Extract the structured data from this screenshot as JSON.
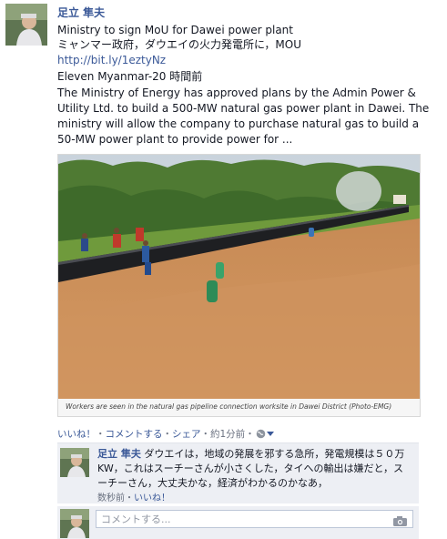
{
  "post": {
    "author": "足立 隼夫",
    "title_en": "Ministry to sign MoU for Dawei power plant",
    "title_jp": "ミャンマー政府，ダウエイの火力発電所に，MOU",
    "link": "http://bit.ly/1eztyNz",
    "source_time": "Eleven Myanmar-20 時間前",
    "body": "The Ministry of Energy has approved plans by the Admin Power & Utility Ltd. to build a 500-MW natural gas power plant in Dawei. The ministry will allow the company to purchase natural gas to build a 50-MW power plant to provide power for ...",
    "photo_caption": "Workers are seen in the natural gas pipeline connection worksite in Dawei District (Photo-EMG)"
  },
  "actions": {
    "like": "いいね！",
    "sep1": "・",
    "comment": "コメントする",
    "sep2": "・",
    "share": "シェア",
    "sep3": "・",
    "time": "約1分前",
    "sep4": "・"
  },
  "comment": {
    "author": "足立 隼夫",
    "text": "ダウエイは，地域の発展を邪する急所，発電規模は５０万KW，これはスーチーさんが小さくした，タイへの輸出は嫌だと，スーチーさん，大丈夫かな，経済がわかるのかなあ，",
    "time": "数秒前",
    "sep": "・",
    "like": "いいね！"
  },
  "composer": {
    "placeholder": "コメントする..."
  },
  "colors": {
    "link": "#3b5998",
    "meta": "#6a7180",
    "comment_bg": "#edeff4"
  }
}
